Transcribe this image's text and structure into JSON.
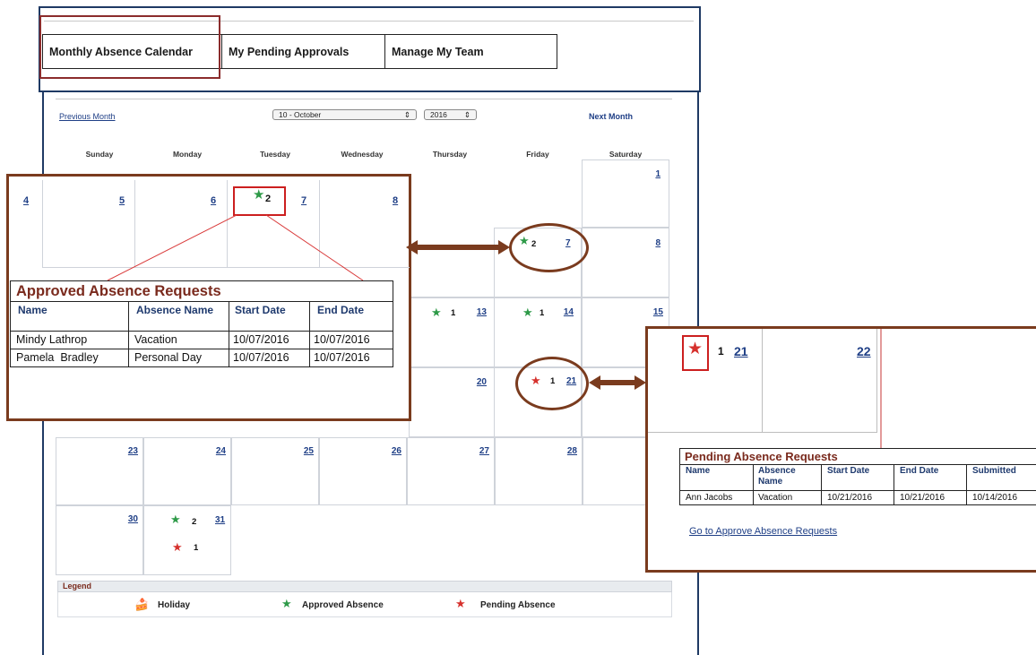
{
  "tabs": [
    {
      "label": "Monthly Absence Calendar"
    },
    {
      "label": "My Pending Approvals"
    },
    {
      "label": "Manage My Team"
    }
  ],
  "nav": {
    "previous": "Previous Month",
    "next": "Next Month",
    "month": "10 - October",
    "year": "2016"
  },
  "weekdays": [
    "Sunday",
    "Monday",
    "Tuesday",
    "Wednesday",
    "Thursday",
    "Friday",
    "Saturday"
  ],
  "days": {
    "d1": "1",
    "d4": "4",
    "d5": "5",
    "d6": "6",
    "d7": "7",
    "d8": "8",
    "d13": "13",
    "d14": "14",
    "d15": "15",
    "d20": "20",
    "d21": "21",
    "d22": "22",
    "d23": "23",
    "d24": "24",
    "d25": "25",
    "d26": "26",
    "d27": "27",
    "d28": "28",
    "d30": "30",
    "d31": "31"
  },
  "counts": {
    "approved_2": "2",
    "approved_1": "1",
    "pending_1": "1"
  },
  "icons": {
    "approved": "★",
    "pending": "★",
    "holiday": "🍰"
  },
  "approved_popup": {
    "title": "Approved Absence Requests",
    "headers": [
      "Name",
      "Absence Name",
      "Start Date",
      "End Date"
    ],
    "rows": [
      [
        "Mindy Lathrop",
        "Vacation",
        "10/07/2016",
        "10/07/2016"
      ],
      [
        "Pamela  Bradley",
        "Personal Day",
        "10/07/2016",
        "10/07/2016"
      ]
    ]
  },
  "pending_popup": {
    "title": "Pending Absence Requests",
    "headers": [
      "Name",
      "Absence Name",
      "Start Date",
      "End Date",
      "Submitted"
    ],
    "rows": [
      [
        "Ann Jacobs",
        "Vacation",
        "10/21/2016",
        "10/21/2016",
        "10/14/2016"
      ]
    ],
    "link": "Go to Approve Absence Requests"
  },
  "legend": {
    "title": "Legend",
    "holiday": "Holiday",
    "approved": "Approved Absence",
    "pending": "Pending Absence"
  },
  "colors": {
    "approved_star": "#2e9a48",
    "pending_star": "#d6312d",
    "frame_navy": "#1f3a64",
    "callout_brown": "#7a3b1e",
    "highlight_red": "#cc1f1f"
  }
}
